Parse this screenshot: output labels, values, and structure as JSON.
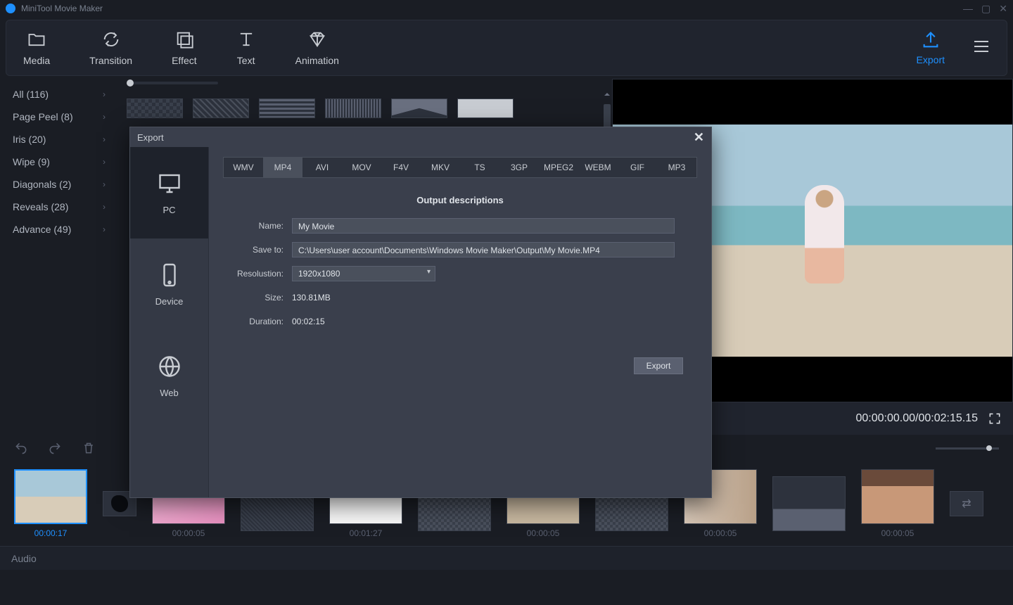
{
  "app_title": "MiniTool Movie Maker",
  "toolbar": {
    "media": "Media",
    "transition": "Transition",
    "effect": "Effect",
    "text": "Text",
    "animation": "Animation",
    "export": "Export"
  },
  "sidebar": [
    {
      "label": "All (116)"
    },
    {
      "label": "Page Peel (8)"
    },
    {
      "label": "Iris (20)"
    },
    {
      "label": "Wipe (9)"
    },
    {
      "label": "Diagonals (2)"
    },
    {
      "label": "Reveals (28)"
    },
    {
      "label": "Advance (49)"
    }
  ],
  "preview": {
    "time_display": "00:00:00.00/00:02:15.15"
  },
  "timeline": {
    "clips": [
      {
        "time": "00:00:17",
        "selected": true,
        "cls": "beachthumb"
      },
      {
        "time": "00:00:05",
        "cls": "pink"
      },
      {
        "time": "00:01:27",
        "cls": "white"
      },
      {
        "time": "00:00:05",
        "cls": "gray"
      },
      {
        "time": "00:00:05",
        "cls": "photo1"
      },
      {
        "time": "00:00:05",
        "cls": "photo2"
      },
      {
        "time": "00:00:05",
        "cls": "wave"
      },
      {
        "time": "00:00:05",
        "cls": "photo3"
      }
    ],
    "audio_label": "Audio"
  },
  "export_dialog": {
    "title": "Export",
    "targets": {
      "pc": "PC",
      "device": "Device",
      "web": "Web"
    },
    "formats": [
      "WMV",
      "MP4",
      "AVI",
      "MOV",
      "F4V",
      "MKV",
      "TS",
      "3GP",
      "MPEG2",
      "WEBM",
      "GIF",
      "MP3"
    ],
    "active_format": "MP4",
    "section_title": "Output descriptions",
    "labels": {
      "name": "Name:",
      "save_to": "Save to:",
      "resolution": "Resolustion:",
      "size": "Size:",
      "duration": "Duration:"
    },
    "values": {
      "name": "My Movie",
      "save_to": "C:\\Users\\user account\\Documents\\Windows Movie Maker\\Output\\My Movie.MP4",
      "resolution": "1920x1080",
      "size": "130.81MB",
      "duration": "00:02:15"
    },
    "export_btn": "Export"
  }
}
